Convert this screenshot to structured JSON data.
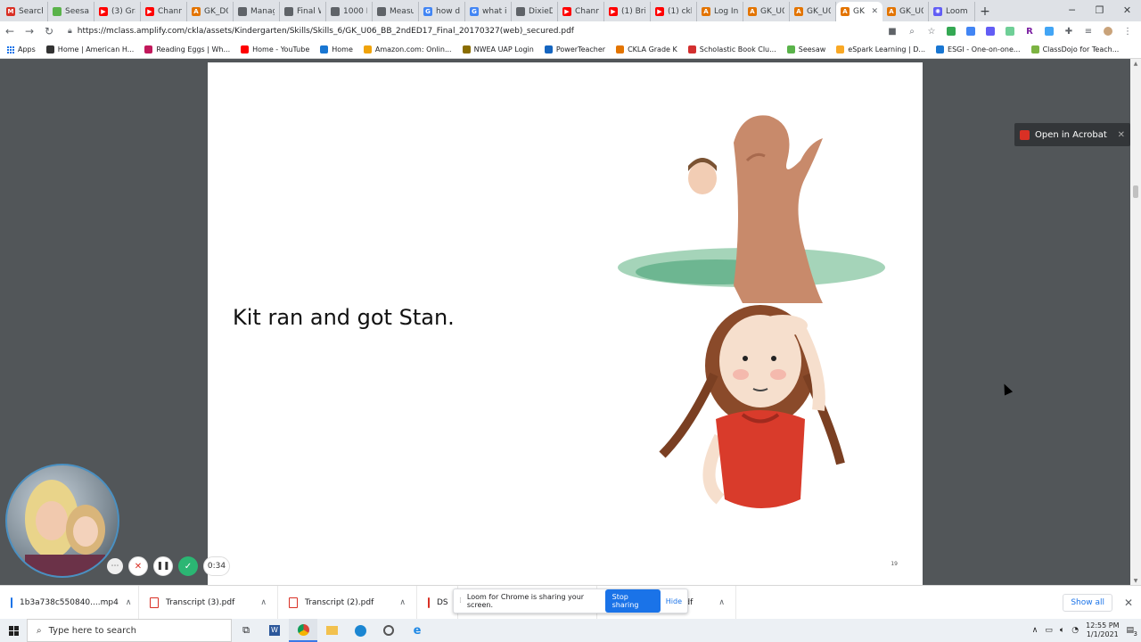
{
  "browser": {
    "tabs": [
      {
        "label": "Search",
        "color": "#d93025",
        "glyph": "M"
      },
      {
        "label": "Seesaw",
        "color": "#5ab34a",
        "glyph": ""
      },
      {
        "label": "(3) Gra",
        "color": "#ff0000",
        "glyph": "▶"
      },
      {
        "label": "Channe",
        "color": "#ff0000",
        "glyph": "▶"
      },
      {
        "label": "GK_D0:",
        "color": "#e37400",
        "glyph": "A"
      },
      {
        "label": "Manag",
        "color": "#5f6368",
        "glyph": ""
      },
      {
        "label": "Final W",
        "color": "#5f6368",
        "glyph": ""
      },
      {
        "label": "1000 H",
        "color": "#5f6368",
        "glyph": ""
      },
      {
        "label": "Measu",
        "color": "#5f6368",
        "glyph": ""
      },
      {
        "label": "how do",
        "color": "#4285f4",
        "glyph": "G"
      },
      {
        "label": "what is",
        "color": "#4285f4",
        "glyph": "G"
      },
      {
        "label": "DixieD",
        "color": "#5f6368",
        "glyph": ""
      },
      {
        "label": "Channe",
        "color": "#ff0000",
        "glyph": "▶"
      },
      {
        "label": "(1) Britt",
        "color": "#ff0000",
        "glyph": "▶"
      },
      {
        "label": "(1) ckla",
        "color": "#ff0000",
        "glyph": "▶"
      },
      {
        "label": "Log In t",
        "color": "#e37400",
        "glyph": "A"
      },
      {
        "label": "GK_U0:",
        "color": "#e37400",
        "glyph": "A"
      },
      {
        "label": "GK_U0:",
        "color": "#e37400",
        "glyph": "A"
      },
      {
        "label": "GK",
        "color": "#e37400",
        "glyph": "A",
        "active": true
      },
      {
        "label": "GK_U0:",
        "color": "#e37400",
        "glyph": "A"
      },
      {
        "label": "Loom |",
        "color": "#625df5",
        "glyph": "✺"
      }
    ],
    "url": "https://mclass.amplify.com/ckla/assets/Kindergarten/Skills/Skills_6/GK_U06_BB_2ndED17_Final_20170327(web)_secured.pdf",
    "bookmarks": [
      {
        "label": "Apps",
        "color": "#1a73e8"
      },
      {
        "label": "Home | American H...",
        "color": "#333333"
      },
      {
        "label": "Reading Eggs | Wh...",
        "color": "#c2185b"
      },
      {
        "label": "Home - YouTube",
        "color": "#ff0000"
      },
      {
        "label": "Home",
        "color": "#1976d2"
      },
      {
        "label": "Amazon.com: Onlin...",
        "color": "#f0a30a"
      },
      {
        "label": "NWEA UAP Login",
        "color": "#8a6d00"
      },
      {
        "label": "PowerTeacher",
        "color": "#1565c0"
      },
      {
        "label": "CKLA Grade K",
        "color": "#e37400"
      },
      {
        "label": "Scholastic Book Clu...",
        "color": "#d32f2f"
      },
      {
        "label": "Seesaw",
        "color": "#5ab34a"
      },
      {
        "label": "eSpark Learning | D...",
        "color": "#f9a825"
      },
      {
        "label": "ESGI - One-on-one...",
        "color": "#1976d2"
      },
      {
        "label": "ClassDojo for Teach...",
        "color": "#7cb342"
      }
    ]
  },
  "pdf": {
    "page_text": "Kit ran and got Stan.",
    "page_number": "19",
    "open_in_acrobat": "Open in Acrobat"
  },
  "loom": {
    "timer": "0:34",
    "share_message": "Loom for Chrome is sharing your screen.",
    "stop_label": "Stop sharing",
    "hide_label": "Hide"
  },
  "downloads": {
    "items": [
      {
        "name": "1b3a738c550840....mp4",
        "type": "video"
      },
      {
        "name": "Transcript (3).pdf",
        "type": "pdf"
      },
      {
        "name": "Transcript (2).pdf",
        "type": "pdf"
      },
      {
        "name": "DS",
        "type": "doc"
      },
      {
        "name": "Transcript (1) (1).pdf",
        "type": "pdf"
      },
      {
        "name": "Transcript (1).pdf",
        "type": "pdf"
      }
    ],
    "show_all": "Show all"
  },
  "taskbar": {
    "search_placeholder": "Type here to search",
    "time": "12:55 PM",
    "date": "1/1/2021",
    "notification_count": "3"
  }
}
